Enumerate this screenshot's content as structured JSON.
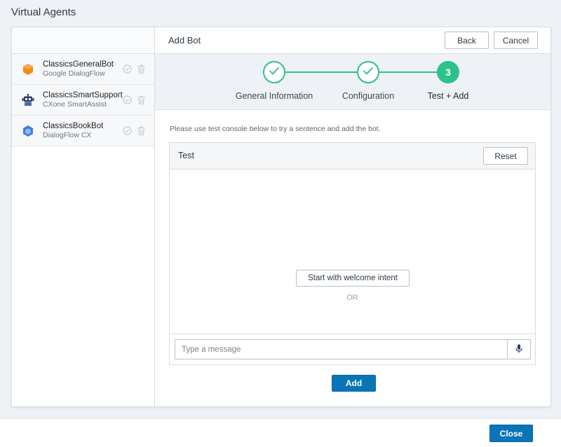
{
  "app": {
    "title": "Virtual Agents"
  },
  "sidebar": {
    "bots": [
      {
        "name": "ClassicsGeneralBot",
        "type": "Google DialogFlow",
        "icon": "hexagon-orange-icon"
      },
      {
        "name": "ClassicsSmartSupport",
        "type": "CXone SmartAssist",
        "icon": "robot-icon"
      },
      {
        "name": "ClassicsBookBot",
        "type": "DialogFlow CX",
        "icon": "cube-blue-icon"
      }
    ]
  },
  "main": {
    "title": "Add Bot",
    "back_label": "Back",
    "cancel_label": "Cancel",
    "steps": [
      {
        "label": "General Information",
        "state": "done"
      },
      {
        "label": "Configuration",
        "state": "done"
      },
      {
        "label": "Test + Add",
        "state": "active",
        "number": "3"
      }
    ],
    "instructions": "Please use test console below to try a sentence and add the bot.",
    "test": {
      "title": "Test",
      "reset_label": "Reset",
      "welcome_label": "Start with welcome intent",
      "or_label": "OR",
      "placeholder": "Type a message"
    },
    "add_label": "Add"
  },
  "footer": {
    "close_label": "Close"
  },
  "colors": {
    "accent": "#0a74b8",
    "step": "#2cc28a"
  }
}
